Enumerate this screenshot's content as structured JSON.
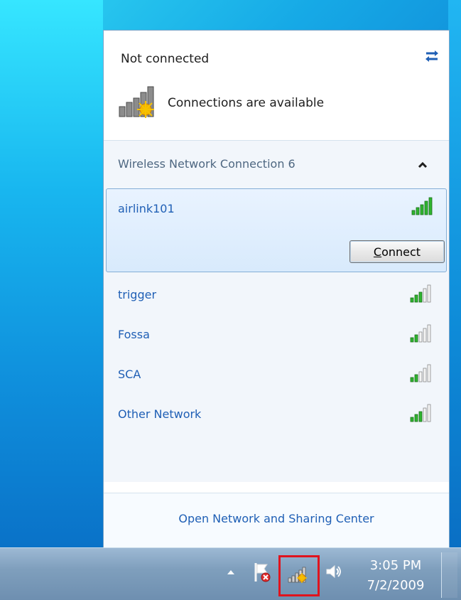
{
  "flyout": {
    "status_title": "Not connected",
    "connections_text": "Connections are available",
    "section_title": "Wireless Network Connection 6",
    "selected_network": {
      "name": "airlink101",
      "signal_bars": 5,
      "connect_label_prefix": "",
      "connect_label_access": "C",
      "connect_label_rest": "onnect"
    },
    "networks": [
      {
        "name": "trigger",
        "signal_bars": 3
      },
      {
        "name": "Fossa",
        "signal_bars": 2
      },
      {
        "name": "SCA",
        "signal_bars": 2
      },
      {
        "name": "Other Network",
        "signal_bars": 3
      }
    ],
    "footer_link": "Open Network and Sharing Center"
  },
  "taskbar": {
    "time": "3:05 PM",
    "date": "7/2/2009"
  },
  "icons": {
    "refresh": "refresh-icon",
    "connections": "signal-warning-icon",
    "chevron": "chevron-up-icon",
    "tray_network": "network-tray-icon",
    "volume": "volume-icon",
    "action_center": "action-center-flag-icon",
    "tray_arrow": "show-hidden-icons-arrow"
  },
  "colors": {
    "link_blue": "#1f5fb5",
    "signal_green": "#2fb52f",
    "highlight_red": "#e0141e"
  }
}
